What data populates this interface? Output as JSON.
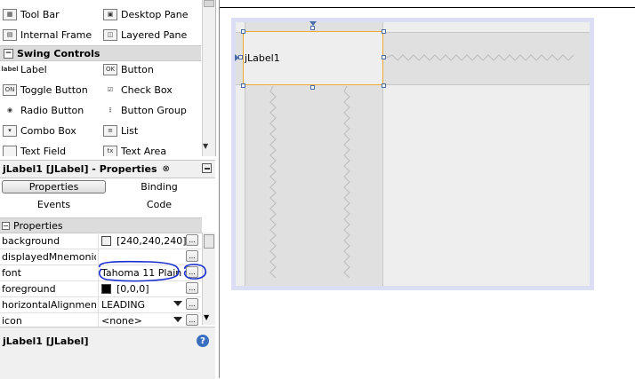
{
  "palette": {
    "items": [
      {
        "label": "Tool Bar",
        "icon": "toolbar-icon"
      },
      {
        "label": "Desktop Pane",
        "icon": "desktop-pane-icon"
      },
      {
        "label": "Internal Frame",
        "icon": "internal-frame-icon"
      },
      {
        "label": "Layered Pane",
        "icon": "layered-pane-icon"
      },
      {
        "label": "Label",
        "icon": "label-icon",
        "glyph": "label"
      },
      {
        "label": "Button",
        "icon": "button-icon",
        "glyph": "OK"
      },
      {
        "label": "Toggle Button",
        "icon": "toggle-button-icon",
        "glyph": "ON"
      },
      {
        "label": "Check Box",
        "icon": "check-box-icon"
      },
      {
        "label": "Radio Button",
        "icon": "radio-button-icon"
      },
      {
        "label": "Button Group",
        "icon": "button-group-icon"
      },
      {
        "label": "Combo Box",
        "icon": "combo-box-icon"
      },
      {
        "label": "List",
        "icon": "list-icon"
      },
      {
        "label": "Text Field",
        "icon": "text-field-icon"
      },
      {
        "label": "Text Area",
        "icon": "text-area-icon",
        "glyph": "tx"
      }
    ],
    "category": "Swing Controls"
  },
  "properties_panel": {
    "title": "jLabel1 [JLabel] - Properties",
    "close_glyph": "⊗",
    "tabs": {
      "properties": "Properties",
      "binding": "Binding",
      "events": "Events",
      "code": "Code"
    },
    "section": "Properties",
    "rows": [
      {
        "name": "background",
        "value": "[240,240,240]",
        "swatch": "#f0f0f0",
        "button": "..."
      },
      {
        "name": "displayedMnemonic",
        "value": "",
        "button": "..."
      },
      {
        "name": "font",
        "value": "Tahoma 11 Plain",
        "button": "..."
      },
      {
        "name": "foreground",
        "value": "[0,0,0]",
        "swatch": "#000000",
        "button": "..."
      },
      {
        "name": "horizontalAlignment",
        "value": "LEADING",
        "dropdown": true,
        "button": "..."
      },
      {
        "name": "icon",
        "value": "<none>",
        "dropdown": true,
        "button": "..."
      }
    ],
    "description_title": "jLabel1 [JLabel]",
    "help_glyph": "?"
  },
  "design": {
    "label_text": "jLabel1"
  },
  "colors": {
    "selection_border": "#f0a830",
    "form_border": "#dcdef4",
    "annotation": "#1a2fd0"
  }
}
